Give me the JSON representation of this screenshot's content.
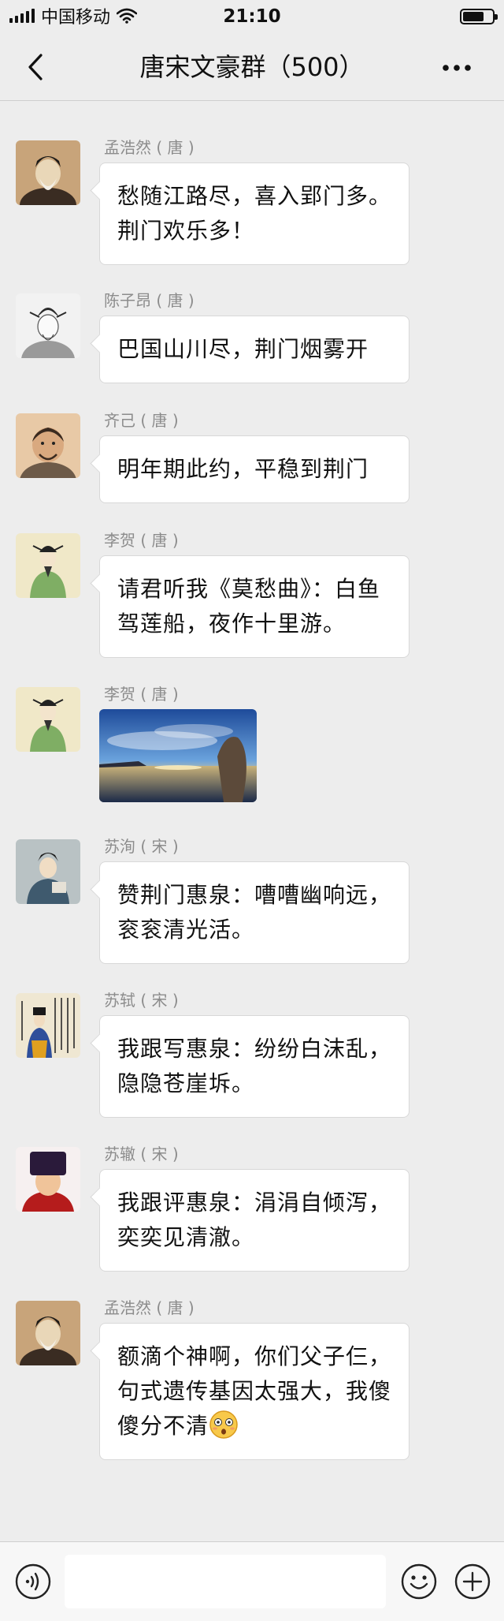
{
  "status_bar": {
    "carrier": "中国移动",
    "time": "21:10",
    "icons": [
      "signal-icon",
      "wifi-icon",
      "battery-icon"
    ]
  },
  "nav": {
    "title": "唐宋文豪群（500）",
    "back_icon": "chevron-left-icon",
    "more_icon": "more-dots-icon"
  },
  "messages": [
    {
      "sender": "孟浩然 ( 唐 )",
      "text": "愁随江路尽，喜入郢门多。荆门欢乐多！",
      "avatar": "avatar-portrait-icon"
    },
    {
      "sender": "陈子昂 ( 唐 )",
      "text": "巴国山川尽，荆门烟雾开",
      "avatar": "avatar-sketch-icon"
    },
    {
      "sender": "齐己 ( 唐 )",
      "text": "明年期此约，平稳到荆门",
      "avatar": "avatar-monk-icon"
    },
    {
      "sender": "李贺 ( 唐 )",
      "text": "请君听我《莫愁曲》：白鱼驾莲船，夜作十里游。",
      "avatar": "avatar-green-robe-icon"
    },
    {
      "sender": "李贺 ( 唐 )",
      "text": "",
      "image": "sunset-lake-photo",
      "avatar": "avatar-green-robe-icon"
    },
    {
      "sender": "苏洵 ( 宋 )",
      "text": "赞荆门惠泉：嘈嘈幽响远，衮衮清光活。",
      "avatar": "avatar-scholar-icon"
    },
    {
      "sender": "苏轼 ( 宋 )",
      "text": "我跟写惠泉：纷纷白沫乱，隐隐苍崖坼。",
      "avatar": "avatar-calligraphy-icon"
    },
    {
      "sender": "苏辙 ( 宋 )",
      "text": "我跟评惠泉：涓涓自倾泻，奕奕见清澈。",
      "avatar": "avatar-official-hat-icon"
    },
    {
      "sender": "孟浩然 ( 唐 )",
      "text": "额滴个神啊，你们父子仨，句式遗传基因太强大，我傻傻分不清",
      "trailing_emoji": "shocked-face-emoji",
      "avatar": "avatar-portrait-icon"
    }
  ],
  "input_bar": {
    "voice_icon": "voice-icon",
    "emoji_icon": "emoji-icon",
    "plus_icon": "plus-icon",
    "input_value": ""
  },
  "colors": {
    "background": "#ededed",
    "bubble": "#ffffff",
    "sender_text": "#8c8c8c",
    "text": "#111111"
  }
}
